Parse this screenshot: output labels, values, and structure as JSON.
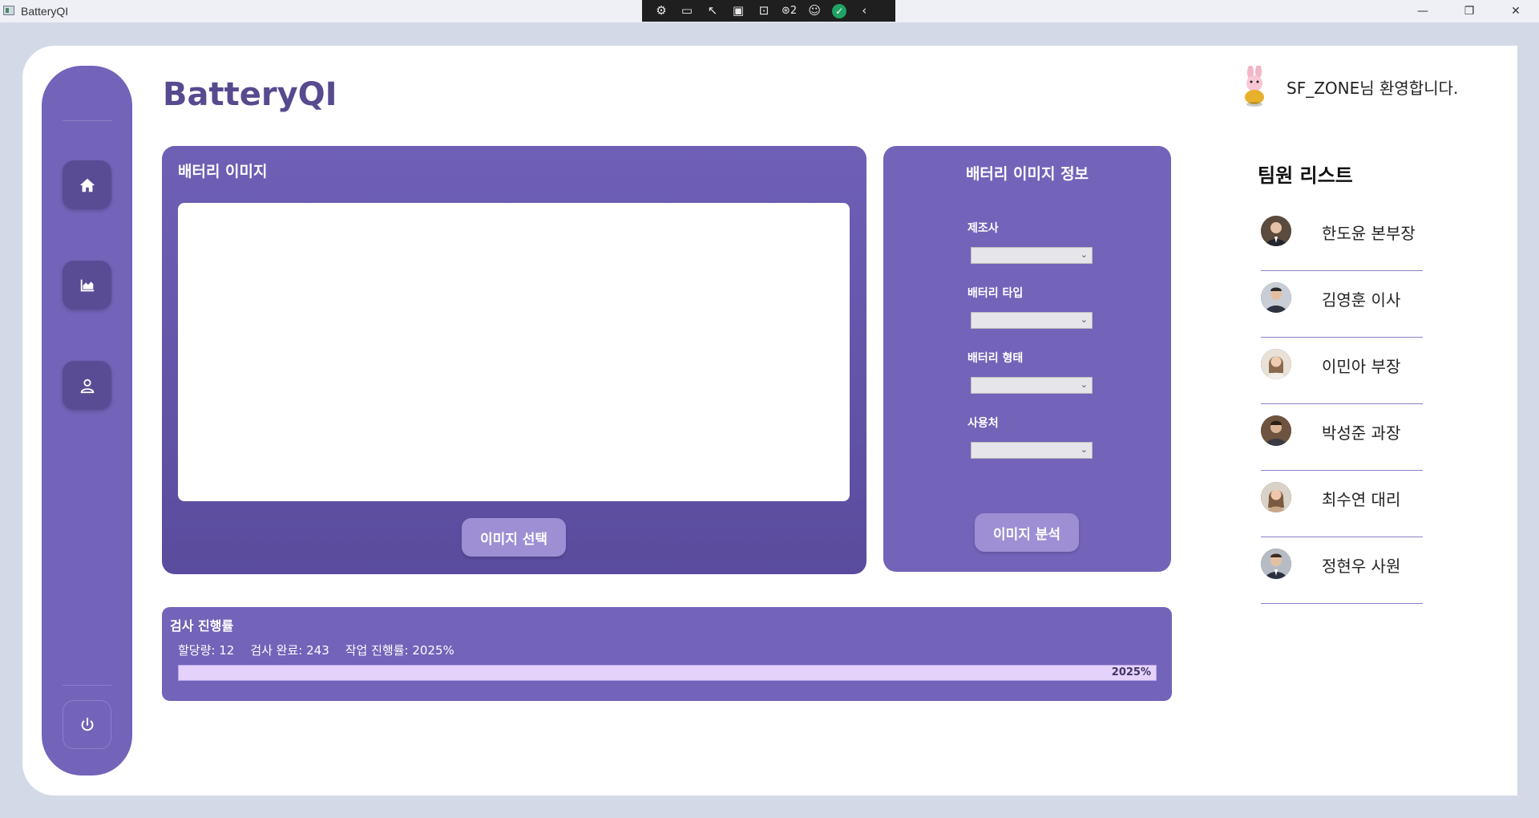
{
  "window": {
    "title": "BatteryQI",
    "debug_badge_count": "2"
  },
  "app_title": "BatteryQI",
  "welcome": {
    "text": "SF_ZONE님 환영합니다."
  },
  "image_card": {
    "title": "배터리 이미지",
    "select_button": "이미지 선택"
  },
  "info_card": {
    "title": "배터리 이미지 정보",
    "fields": [
      {
        "label": "제조사",
        "value": ""
      },
      {
        "label": "배터리 타입",
        "value": ""
      },
      {
        "label": "배터리 형태",
        "value": ""
      },
      {
        "label": "사용처",
        "value": ""
      }
    ],
    "analyze_button": "이미지 분석"
  },
  "progress": {
    "title": "검사 진행률",
    "assigned": "할당량: 12",
    "completed": "검사 완료: 243",
    "rate": "작업 진행률: 2025%",
    "bar_label": "2025%",
    "bar_fill_fraction": 1.0
  },
  "team": {
    "title": "팀원 리스트",
    "members": [
      {
        "name": "한도윤 본부장"
      },
      {
        "name": "김영훈 이사"
      },
      {
        "name": "이민아 부장"
      },
      {
        "name": "박성준 과장"
      },
      {
        "name": "최수연 대리"
      },
      {
        "name": "정현우 사원"
      }
    ]
  },
  "sidebar": {
    "icons": [
      "home-icon",
      "chart-icon",
      "user-icon",
      "power-icon"
    ]
  },
  "colors": {
    "accent": "#7363b9",
    "accent_dark": "#5a4b95",
    "title": "#584a8f"
  }
}
